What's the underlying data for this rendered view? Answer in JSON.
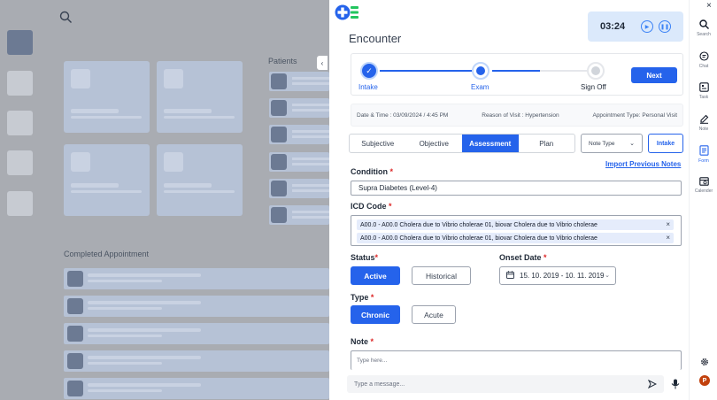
{
  "background": {
    "patients_label": "Patients",
    "completed_label": "Completed Appointment"
  },
  "timer": {
    "value": "03:24"
  },
  "encounter": {
    "title": "Encounter"
  },
  "stepper": {
    "steps": [
      {
        "label": "Intake",
        "state": "done"
      },
      {
        "label": "Exam",
        "state": "current"
      },
      {
        "label": "Sign Off",
        "state": "pending"
      }
    ],
    "next_label": "Next"
  },
  "info": {
    "datetime": "Date & Time :  03/09/2024 / 4:45 PM",
    "reason": "Reason of Visit : Hypertension",
    "appt_type": "Appointment Type: Personal Visit"
  },
  "tabs": [
    "Subjective",
    "Objective",
    "Assessment",
    "Plan"
  ],
  "active_tab": "Assessment",
  "note_type_label": "Note Type",
  "intake_label": "Intake",
  "import_link": "Import Previous Notes",
  "form": {
    "condition_label": "Condition",
    "condition_value": "Supra Diabetes (Level-4)",
    "icd_label": "ICD Code",
    "icd_codes": [
      "A00.0 - A00.0 Cholera due to Vibrio cholerae 01, biovar  Cholera due to Vibrio cholerae",
      "A00.0 - A00.0 Cholera due to Vibrio cholerae 01, biovar  Cholera due to Vibrio cholerae"
    ],
    "status_label": "Status",
    "status_options": [
      "Active",
      "Historical"
    ],
    "status_selected": "Active",
    "onset_label": "Onset Date",
    "onset_value": "15. 10. 2019  -  10. 11. 2019",
    "type_label": "Type",
    "type_options": [
      "Chronic",
      "Acute"
    ],
    "type_selected": "Chronic",
    "note_label": "Note",
    "note_placeholder": "Type here..."
  },
  "message": {
    "placeholder": "Type a message..."
  },
  "rail": {
    "items": [
      {
        "label": "Search",
        "icon": "search-icon"
      },
      {
        "label": "Chat",
        "icon": "chat-icon"
      },
      {
        "label": "Task",
        "icon": "task-icon"
      },
      {
        "label": "Note",
        "icon": "note-icon"
      },
      {
        "label": "Form",
        "icon": "form-icon"
      },
      {
        "label": "Calender",
        "icon": "calendar-icon"
      }
    ],
    "active": "Form",
    "avatar_initial": "P"
  },
  "colors": {
    "accent": "#2563eb",
    "required": "#dc2626",
    "overlay": "#a9acb2"
  }
}
